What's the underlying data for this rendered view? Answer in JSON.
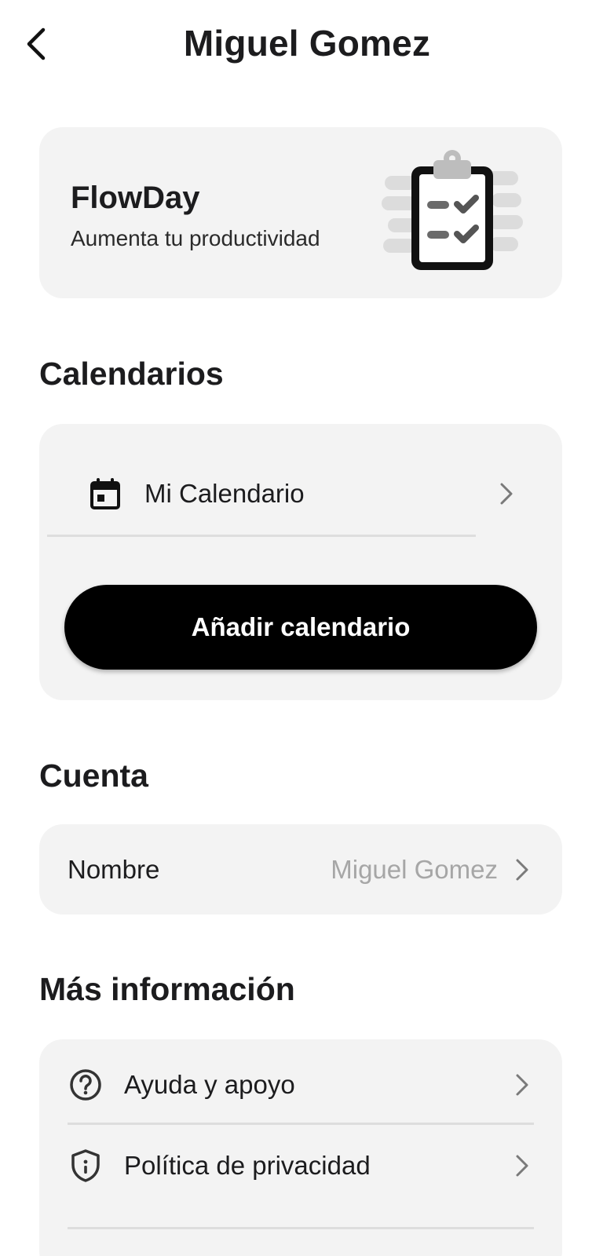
{
  "header": {
    "title": "Miguel Gomez",
    "back_icon": "chevron-left-icon"
  },
  "promo": {
    "app_name": "FlowDay",
    "tagline": "Aumenta tu productividad",
    "art_icon": "clipboard-checklist-icon"
  },
  "calendars": {
    "title": "Calendarios",
    "items": [
      {
        "label": "Mi Calendario",
        "icon": "calendar-icon"
      }
    ],
    "add_label": "Añadir calendario"
  },
  "account": {
    "title": "Cuenta",
    "name_label": "Nombre",
    "name_value": "Miguel Gomez"
  },
  "more_info": {
    "title": "Más información",
    "items": [
      {
        "label": "Ayuda y apoyo",
        "icon": "help-circle-icon"
      },
      {
        "label": "Política de privacidad",
        "icon": "shield-icon"
      }
    ]
  },
  "colors": {
    "card_bg": "#f3f3f3",
    "primary_button": "#000000",
    "muted_text": "#a6a6a6",
    "divider": "#dddddd"
  }
}
